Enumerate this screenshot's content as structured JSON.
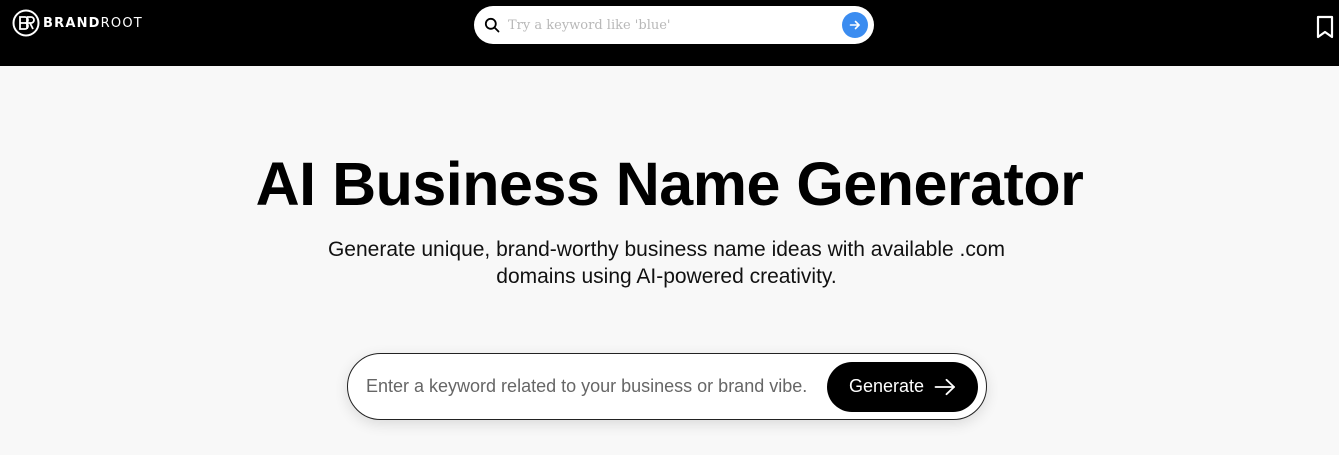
{
  "header": {
    "logo": {
      "bold": "BRAND",
      "light": "ROOT",
      "mark": "BR"
    },
    "search": {
      "placeholder": "Try a keyword like 'blue'"
    },
    "icons": {
      "search": "search-icon",
      "go": "arrow-right-icon",
      "bookmark": "bookmark-icon"
    }
  },
  "hero": {
    "title": "AI Business Name Generator",
    "subtitle": "Generate unique, brand-worthy business name ideas with available .com domains using AI-powered creativity."
  },
  "generator": {
    "placeholder": "Enter a keyword related to your business or brand vibe.",
    "button_label": "Generate"
  },
  "colors": {
    "header_bg": "#000000",
    "page_bg": "#f8f8f8",
    "accent_blue": "#3b8cf0",
    "button_bg": "#000000"
  }
}
